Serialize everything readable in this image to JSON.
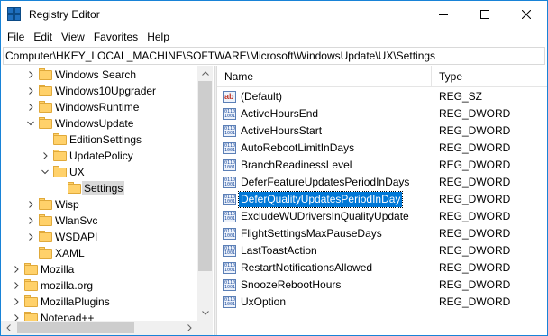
{
  "window": {
    "title": "Registry Editor",
    "accent": "#1883d7"
  },
  "menu": [
    "File",
    "Edit",
    "View",
    "Favorites",
    "Help"
  ],
  "address": "Computer\\HKEY_LOCAL_MACHINE\\SOFTWARE\\Microsoft\\WindowsUpdate\\UX\\Settings",
  "tree": {
    "items": [
      {
        "label": "Windows Search",
        "depth": 0,
        "state": "collapsed"
      },
      {
        "label": "Windows10Upgrader",
        "depth": 0,
        "state": "collapsed"
      },
      {
        "label": "WindowsRuntime",
        "depth": 0,
        "state": "collapsed"
      },
      {
        "label": "WindowsUpdate",
        "depth": 0,
        "state": "expanded"
      },
      {
        "label": "EditionSettings",
        "depth": 1,
        "state": "leaf"
      },
      {
        "label": "UpdatePolicy",
        "depth": 1,
        "state": "collapsed"
      },
      {
        "label": "UX",
        "depth": 1,
        "state": "expanded"
      },
      {
        "label": "Settings",
        "depth": 2,
        "state": "leaf",
        "selected": true
      },
      {
        "label": "Wisp",
        "depth": 0,
        "state": "collapsed"
      },
      {
        "label": "WlanSvc",
        "depth": 0,
        "state": "collapsed"
      },
      {
        "label": "WSDAPI",
        "depth": 0,
        "state": "collapsed"
      },
      {
        "label": "XAML",
        "depth": 0,
        "state": "leaf"
      },
      {
        "label": "Mozilla",
        "depth": -1,
        "state": "collapsed"
      },
      {
        "label": "mozilla.org",
        "depth": -1,
        "state": "collapsed"
      },
      {
        "label": "MozillaPlugins",
        "depth": -1,
        "state": "collapsed"
      },
      {
        "label": "Notepad++",
        "depth": -1,
        "state": "collapsed"
      }
    ]
  },
  "list": {
    "columns": {
      "name": "Name",
      "type": "Type"
    },
    "rows": [
      {
        "name": "(Default)",
        "type": "REG_SZ",
        "icon": "reg-sz-icon"
      },
      {
        "name": "ActiveHoursEnd",
        "type": "REG_DWORD",
        "icon": "reg-dword-icon"
      },
      {
        "name": "ActiveHoursStart",
        "type": "REG_DWORD",
        "icon": "reg-dword-icon"
      },
      {
        "name": "AutoRebootLimitInDays",
        "type": "REG_DWORD",
        "icon": "reg-dword-icon"
      },
      {
        "name": "BranchReadinessLevel",
        "type": "REG_DWORD",
        "icon": "reg-dword-icon"
      },
      {
        "name": "DeferFeatureUpdatesPeriodInDays",
        "type": "REG_DWORD",
        "icon": "reg-dword-icon"
      },
      {
        "name": "DeferQualityUpdatesPeriodInDay",
        "type": "REG_DWORD",
        "icon": "reg-dword-icon",
        "selected": true
      },
      {
        "name": "ExcludeWUDriversInQualityUpdate",
        "type": "REG_DWORD",
        "icon": "reg-dword-icon"
      },
      {
        "name": "FlightSettingsMaxPauseDays",
        "type": "REG_DWORD",
        "icon": "reg-dword-icon"
      },
      {
        "name": "LastToastAction",
        "type": "REG_DWORD",
        "icon": "reg-dword-icon"
      },
      {
        "name": "RestartNotificationsAllowed",
        "type": "REG_DWORD",
        "icon": "reg-dword-icon"
      },
      {
        "name": "SnoozeRebootHours",
        "type": "REG_DWORD",
        "icon": "reg-dword-icon"
      },
      {
        "name": "UxOption",
        "type": "REG_DWORD",
        "icon": "reg-dword-icon"
      }
    ]
  },
  "colors": {
    "selection": "#0078d7",
    "folder": "#ffd16a"
  }
}
